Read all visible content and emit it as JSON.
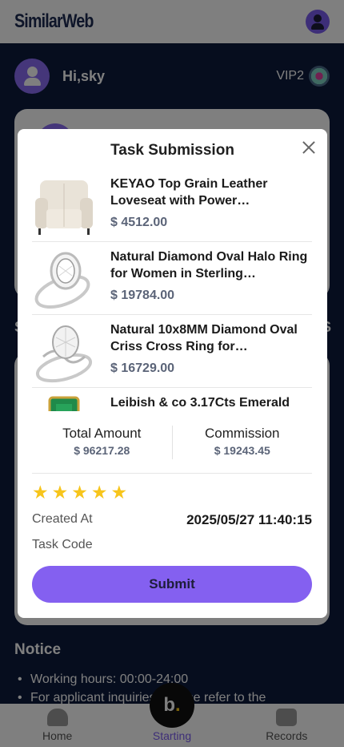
{
  "app": {
    "brand": "SimilarWeb"
  },
  "user": {
    "greeting": "Hi,sky",
    "vip": "VIP2"
  },
  "background": {
    "side_letter_left": "S",
    "side_letter_right": "S"
  },
  "notice": {
    "title": "Notice",
    "items": [
      "Working hours: 00:00-24:00",
      "For applicant inquiries, please refer to the"
    ]
  },
  "nav": {
    "home": "Home",
    "starting": "Starting",
    "records": "Records",
    "center_label": "b",
    "center_dot": "."
  },
  "modal": {
    "title": "Task Submission",
    "products": [
      {
        "name": "KEYAO Top Grain Leather Loveseat with Power…",
        "price": "$ 4512.00",
        "image": "loveseat"
      },
      {
        "name": "Natural Diamond Oval Halo Ring for Women in Sterling…",
        "price": "$ 19784.00",
        "image": "halo-ring"
      },
      {
        "name": "Natural 10x8MM Diamond Oval Criss Cross Ring for…",
        "price": "$ 16729.00",
        "image": "criss-cross-ring"
      },
      {
        "name": "Leibish & co 3.17Cts Emerald",
        "price": "",
        "image": "emerald"
      }
    ],
    "total_amount_label": "Total Amount",
    "total_amount": "$ 96217.28",
    "commission_label": "Commission",
    "commission": "$ 19243.45",
    "rating": 5,
    "created_at_label": "Created At",
    "created_at": "2025/05/27 11:40:15",
    "task_code_label": "Task Code",
    "task_code": "",
    "submit_label": "Submit"
  },
  "colors": {
    "accent": "#8460f0",
    "star": "#f7c51b",
    "price": "#5b6478",
    "navy": "#0d1b3d"
  }
}
